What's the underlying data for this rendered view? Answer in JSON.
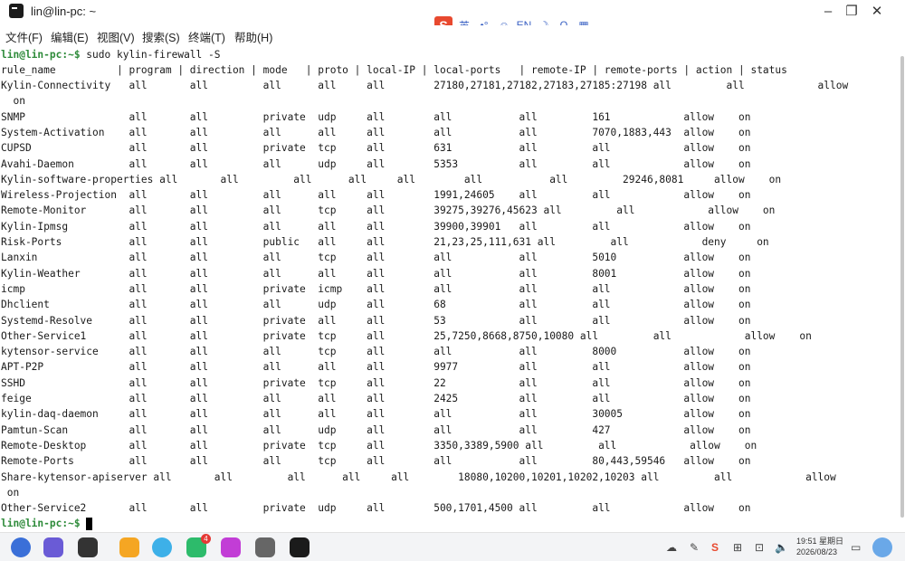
{
  "window": {
    "title": "lin@lin-pc: ~"
  },
  "window_controls": {
    "minimize": "–",
    "maximize": "❐",
    "close": "✕"
  },
  "ime": {
    "logo": "S",
    "mode": "英",
    "items": [
      "•°",
      "☺",
      "EN",
      "☽",
      "Ω",
      "▦"
    ]
  },
  "menubar": {
    "items": [
      "文件(F)",
      "编辑(E)",
      "视图(V)",
      "搜索(S)",
      "终端(T)",
      "帮助(H)"
    ]
  },
  "terminal": {
    "prompt": "lin@lin-pc:~$",
    "command": " sudo kylin-firewall -S",
    "header": "rule_name          | program | direction | mode   | proto | local-IP | local-ports   | remote-IP | remote-ports | action | status",
    "rows": [
      "Kylin-Connectivity   all       all         all      all     all        27180,27181,27182,27183,27185:27198 all         all            allow",
      "  on",
      "SNMP                 all       all         private  udp     all        all           all         161            allow    on",
      "System-Activation    all       all         all      all     all        all           all         7070,1883,443  allow    on",
      "CUPSD                all       all         private  tcp     all        631           all         all            allow    on",
      "Avahi-Daemon         all       all         all      udp     all        5353          all         all            allow    on",
      "Kylin-software-properties all       all         all      all     all        all           all         29246,8081     allow    on",
      "Wireless-Projection  all       all         all      all     all        1991,24605    all         all            allow    on",
      "Remote-Monitor       all       all         all      tcp     all        39275,39276,45623 all         all            allow    on",
      "Kylin-Ipmsg          all       all         all      all     all        39900,39901   all         all            allow    on",
      "Risk-Ports           all       all         public   all     all        21,23,25,111,631 all         all            deny     on",
      "Lanxin               all       all         all      tcp     all        all           all         5010           allow    on",
      "Kylin-Weather        all       all         all      all     all        all           all         8001           allow    on",
      "icmp                 all       all         private  icmp    all        all           all         all            allow    on",
      "Dhclient             all       all         all      udp     all        68            all         all            allow    on",
      "Systemd-Resolve      all       all         private  all     all        53            all         all            allow    on",
      "Other-Service1       all       all         private  tcp     all        25,7250,8668,8750,10080 all         all            allow    on",
      "kytensor-service     all       all         all      tcp     all        all           all         8000           allow    on",
      "APT-P2P              all       all         all      all     all        9977          all         all            allow    on",
      "SSHD                 all       all         private  tcp     all        22            all         all            allow    on",
      "feige                all       all         all      all     all        2425          all         all            allow    on",
      "kylin-daq-daemon     all       all         all      all     all        all           all         30005          allow    on",
      "Pamtun-Scan          all       all         all      udp     all        all           all         427            allow    on",
      "Remote-Desktop       all       all         private  tcp     all        3350,3389,5900 all         all            allow    on",
      "Remote-Ports         all       all         all      tcp     all        all           all         80,443,59546   allow    on",
      "Share-kytensor-apiserver all       all         all      all     all        18080,10200,10201,10202,10203 all         all            allow",
      " on",
      "Other-Service2       all       all         private  udp     all        500,1701,4500 all         all            allow    on"
    ]
  },
  "taskbar": {
    "apps": [
      "start-menu",
      "search",
      "multitask",
      "file-manager",
      "browser",
      "chat",
      "camera",
      "settings",
      "terminal"
    ],
    "badge": "4",
    "tray": [
      "☁",
      "✎",
      "S",
      "⊞",
      "⊡",
      "🔈"
    ],
    "time": "19:51 星期日",
    "date": "2026/08/23"
  },
  "colors": {
    "prompt": "#2e8b3a",
    "ime_logo": "#e8492f"
  }
}
